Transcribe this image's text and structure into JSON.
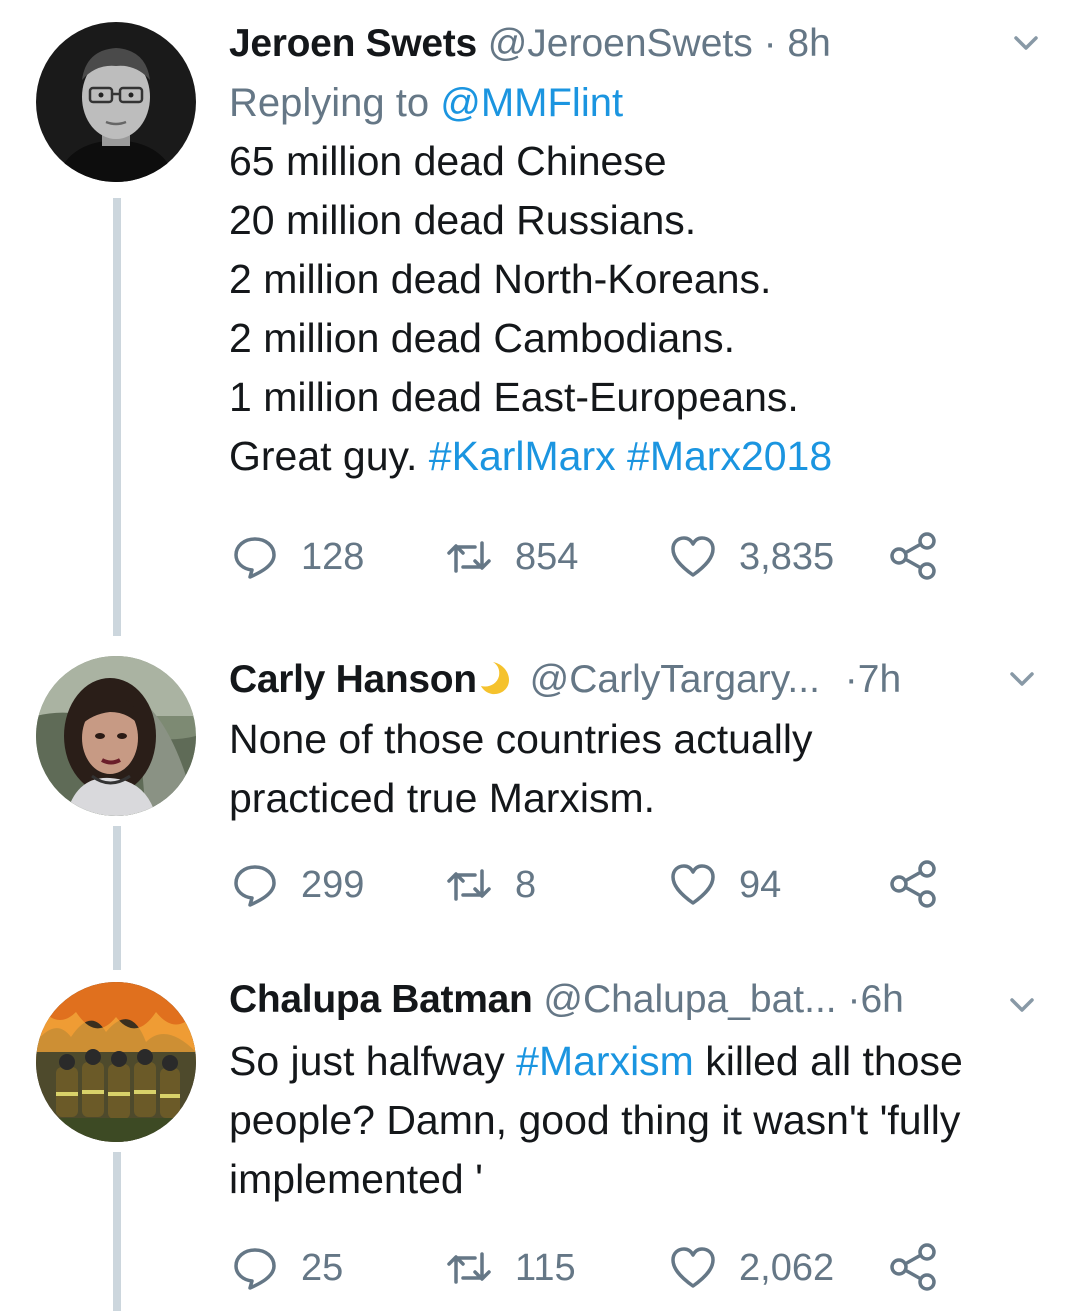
{
  "colors": {
    "link": "#1b95e0",
    "muted": "#657786",
    "thread_line": "#ccd6dd",
    "text": "#14171a"
  },
  "tweets": [
    {
      "name": "Jeroen Swets",
      "handle": "@JeroenSwets",
      "separator": "·",
      "time": "8h",
      "replying_prefix": "Replying to",
      "replying_to": "@MMFlint",
      "lines": [
        "65 million dead Chinese",
        "20 million dead Russians.",
        "2 million dead North-Koreans.",
        "2 million dead Cambodians.",
        "1 million dead East-Europeans."
      ],
      "last_line_text": "Great guy.",
      "hashtags": [
        "#KarlMarx",
        "#Marx2018"
      ],
      "reply_count": "128",
      "retweet_count": "854",
      "like_count": "3,835",
      "avatar_icon": "profile-photo-man-glasses"
    },
    {
      "name": "Carly Hanson",
      "name_emoji_icon": "crescent-moon-icon",
      "handle": "@CarlyTargary...",
      "separator": "·",
      "time": "7h",
      "lines": [
        "None of those countries actually",
        "practiced true Marxism."
      ],
      "reply_count": "299",
      "retweet_count": "8",
      "like_count": "94",
      "avatar_icon": "profile-photo-woman"
    },
    {
      "name": "Chalupa Batman",
      "handle": "@Chalupa_bat...",
      "separator": "·",
      "time": "6h",
      "line1_before": "So just halfway",
      "line1_hashtag": "#Marxism",
      "line1_after": "killed all those",
      "lines": [
        "people? Damn, good thing it wasn't 'fully",
        "implemented '"
      ],
      "reply_count": "25",
      "retweet_count": "115",
      "like_count": "2,062",
      "avatar_icon": "profile-photo-firefighters"
    }
  ]
}
